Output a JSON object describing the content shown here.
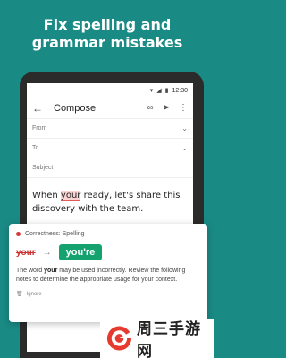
{
  "headline": {
    "line1": "Fix spelling and",
    "line2": "grammar mistakes"
  },
  "statusbar": {
    "time": "12:30",
    "icons": [
      "wifi-icon",
      "signal-icon",
      "battery-icon"
    ]
  },
  "toolbar": {
    "back_icon": "arrow-left-icon",
    "title": "Compose",
    "icons": [
      "attach-icon",
      "send-icon",
      "more-vert-icon"
    ]
  },
  "fields": {
    "from": "From",
    "to": "To",
    "subject": "Subject"
  },
  "body": {
    "before": "When ",
    "flagged": "your",
    "after": " ready, let's share this discovery with the team."
  },
  "card": {
    "category": "Correctness: Spelling",
    "wrong": "your",
    "suggestion": "you're",
    "explanation_pre": "The word ",
    "explanation_word": "your",
    "explanation_post": " may be used incorrectly. Review the following notes to determine the appropriate usage for your context.",
    "ignore_label": "Ignore"
  },
  "watermark": {
    "text": "周三手游网"
  },
  "colors": {
    "background": "#1a8a85",
    "accent_green": "#14a36f",
    "error_red": "#d23b3b"
  }
}
